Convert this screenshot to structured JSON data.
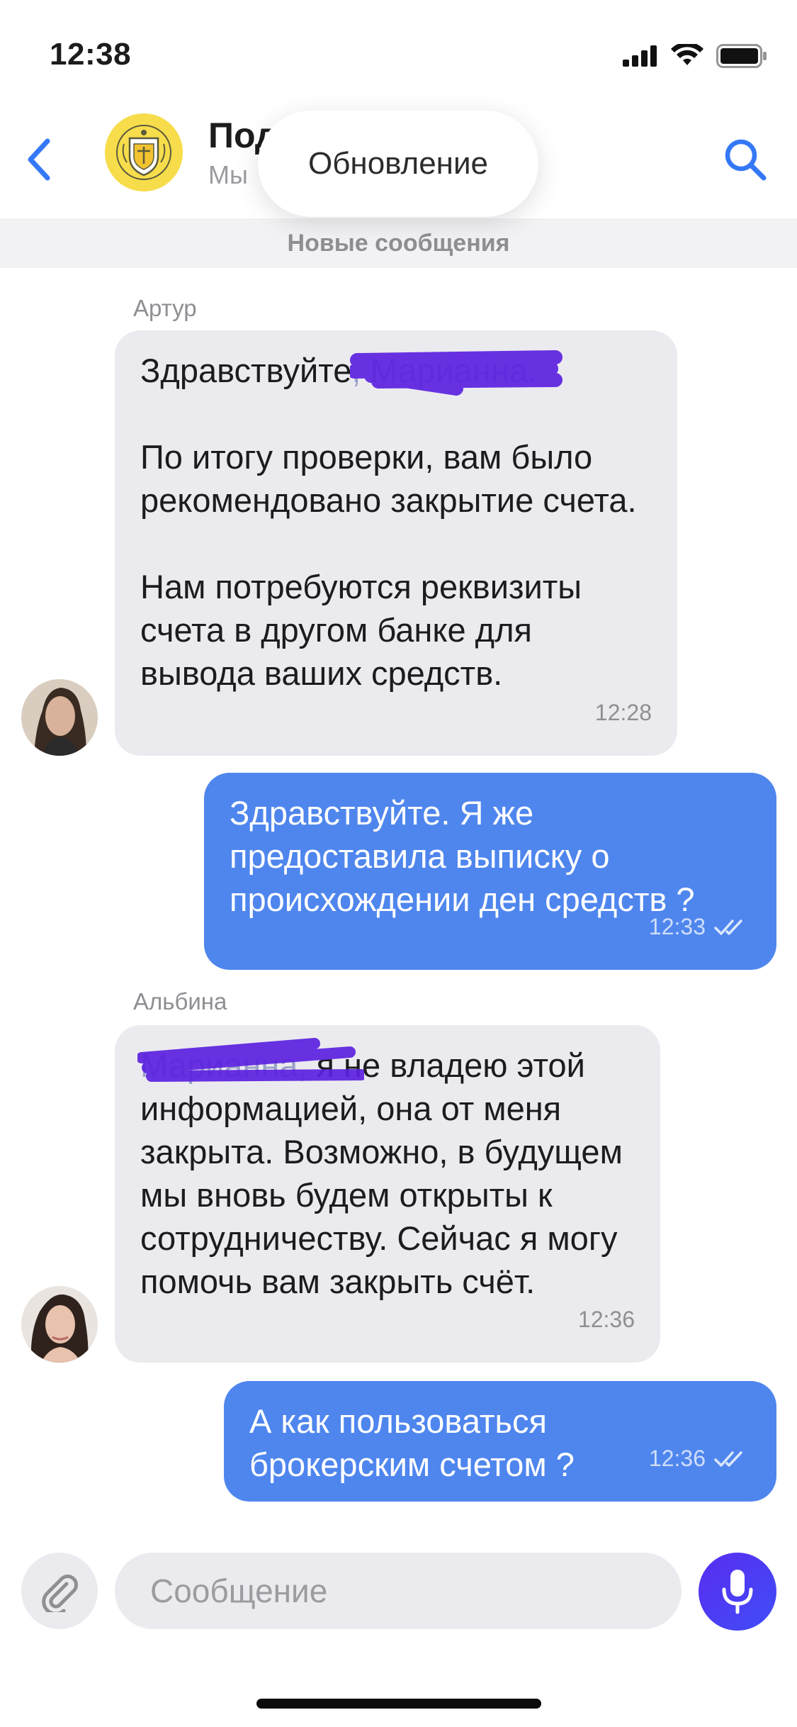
{
  "status_bar": {
    "time": "12:38"
  },
  "header": {
    "title": "Под",
    "subtitle": "Мы",
    "update_label": "Обновление"
  },
  "divider": {
    "label": "Новые сообщения"
  },
  "messages": [
    {
      "sender": "Артур",
      "direction": "incoming",
      "greeting": "Здравствуйте",
      "greeting_redacted": ", Марианна.",
      "lines": [
        "По итогу проверки, вам было рекомендовано закрытие счета.",
        "Нам потребуются реквизиты счета в другом банке для вывода ваших средств."
      ],
      "time": "12:28"
    },
    {
      "direction": "outgoing",
      "text": "Здравствуйте. Я же предоставила выписку о происхождении ден средств ?",
      "time": "12:33"
    },
    {
      "sender": "Альбина",
      "direction": "incoming",
      "redacted_prefix": "Марианна,",
      "text": " я не владею этой информацией, она от меня закрыта. Возможно, в будущем мы вновь будем открыты к сотрудничеству. Сейчас я могу помочь вам закрыть счёт.",
      "time": "12:36"
    },
    {
      "direction": "outgoing",
      "text": "А как пользоваться брокерским счетом ?",
      "time": "12:36"
    }
  ],
  "composer": {
    "placeholder": "Сообщение"
  },
  "colors": {
    "accent": "#4f86ee",
    "incoming_bubble": "#ebebef",
    "mic_button": "#5a2cf0",
    "redaction": "#5b21e0",
    "bank_logo": "#f7dc4b"
  },
  "icons": {
    "back": "chevron-left-icon",
    "search": "search-icon",
    "attach": "paperclip-icon",
    "mic": "microphone-icon",
    "read": "double-check-icon"
  }
}
